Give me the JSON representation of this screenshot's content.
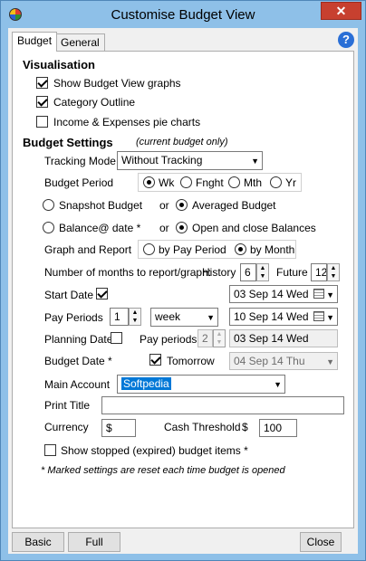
{
  "window": {
    "title": "Customise Budget View",
    "close_glyph": "✕",
    "app_icon": "pie-chart-icon"
  },
  "tabs": [
    {
      "label": "Budget"
    },
    {
      "label": "General"
    }
  ],
  "help": {
    "glyph": "?"
  },
  "visualisation": {
    "heading": "Visualisation",
    "show_graphs": {
      "label": "Show Budget View graphs",
      "checked": true
    },
    "category_outline": {
      "label": "Category Outline",
      "checked": true
    },
    "pie_charts": {
      "label": "Income & Expenses pie charts",
      "checked": false
    }
  },
  "budget_settings": {
    "heading": "Budget Settings",
    "note": "(current budget only)",
    "tracking_mode": {
      "label": "Tracking Mode",
      "value": "Without Tracking"
    },
    "budget_period": {
      "label": "Budget Period",
      "options": [
        "Wk",
        "Fnght",
        "Mth",
        "Yr"
      ],
      "selected": "Wk"
    },
    "snapshot_budget": "Snapshot Budget",
    "or1": "or",
    "averaged_budget": "Averaged Budget",
    "balance_at_date": "Balance@ date *",
    "or2": "or",
    "open_close_balances": "Open and close Balances",
    "graph_report": {
      "label": "Graph and Report",
      "by_pay_period": "by Pay Period",
      "by_month": "by Month"
    },
    "months_to_report": {
      "label": "Number of months to report/graph:",
      "history_label": "History",
      "history_value": "6",
      "future_label": "Future",
      "future_value": "12"
    },
    "start_date": {
      "label": "Start Date",
      "checked": true,
      "value": "03 Sep 14 Wed"
    },
    "pay_periods": {
      "label": "Pay Periods",
      "count": "1",
      "unit": "week",
      "date": "10 Sep 14 Wed"
    },
    "planning_date": {
      "label": "Planning Date",
      "checked": false,
      "pay_periods_label": "Pay periods",
      "pay_periods_value": "2",
      "date": "03 Sep 14 Wed"
    },
    "budget_date": {
      "label": "Budget Date *",
      "tomorrow_label": "Tomorrow",
      "tomorrow_checked": true,
      "date": "04 Sep 14 Thu"
    },
    "main_account": {
      "label": "Main Account",
      "value": "Softpedia"
    },
    "print_title": {
      "label": "Print Title",
      "value": ""
    },
    "currency": {
      "label": "Currency",
      "value": "$"
    },
    "cash_threshold": {
      "label": "Cash Threshold",
      "symbol": "$",
      "value": "100"
    },
    "show_stopped": {
      "label": "Show stopped (expired) budget items *",
      "checked": false
    },
    "footnote": "* Marked settings are reset each time budget is opened"
  },
  "footer": {
    "basic": "Basic",
    "full": "Full",
    "close": "Close"
  }
}
